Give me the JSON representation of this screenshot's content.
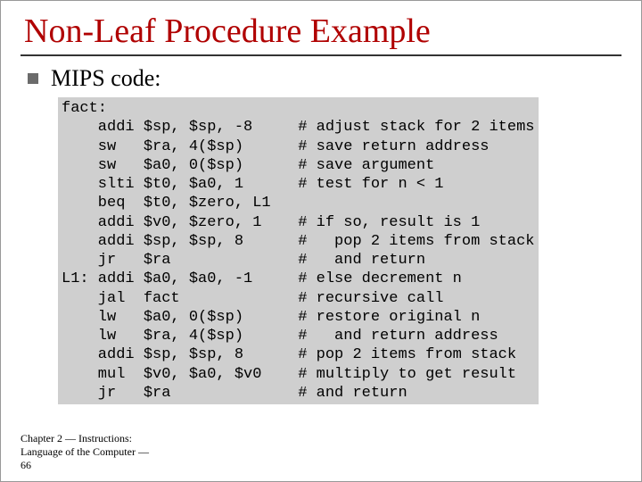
{
  "title": "Non-Leaf Procedure Example",
  "subhead": "MIPS code:",
  "code": "fact:\n    addi $sp, $sp, -8     # adjust stack for 2 items\n    sw   $ra, 4($sp)      # save return address\n    sw   $a0, 0($sp)      # save argument\n    slti $t0, $a0, 1      # test for n < 1\n    beq  $t0, $zero, L1\n    addi $v0, $zero, 1    # if so, result is 1\n    addi $sp, $sp, 8      #   pop 2 items from stack\n    jr   $ra              #   and return\nL1: addi $a0, $a0, -1     # else decrement n\n    jal  fact             # recursive call\n    lw   $a0, 0($sp)      # restore original n\n    lw   $ra, 4($sp)      #   and return address\n    addi $sp, $sp, 8      # pop 2 items from stack\n    mul  $v0, $a0, $v0    # multiply to get result\n    jr   $ra              # and return",
  "footer": "Chapter 2 — Instructions:\nLanguage of the Computer —\n66"
}
